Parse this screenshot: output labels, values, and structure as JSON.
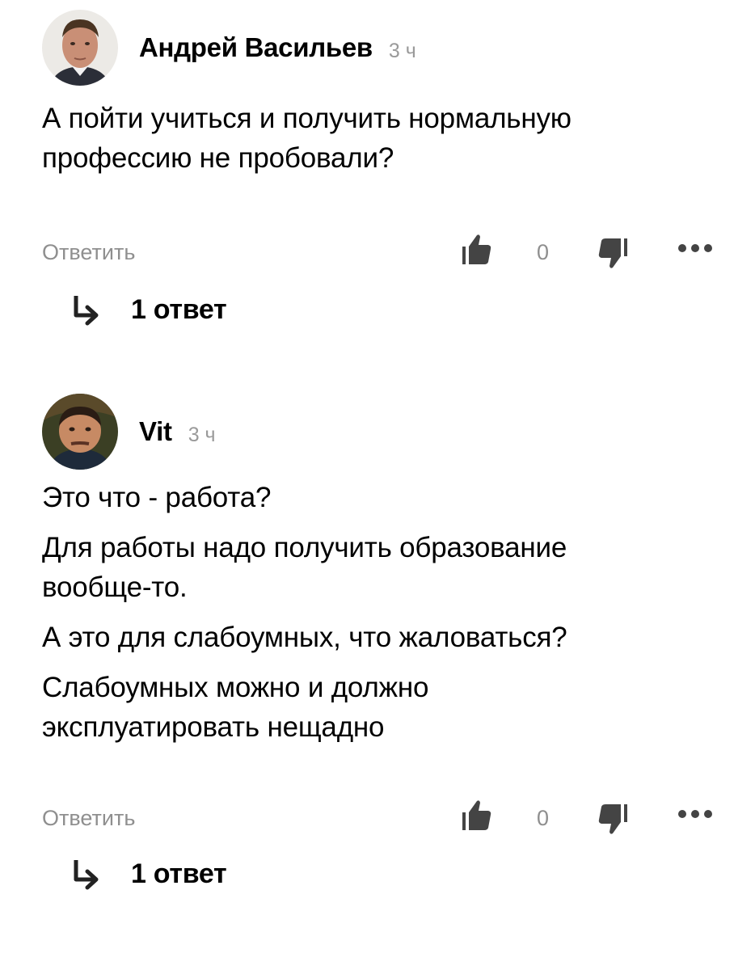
{
  "comments": [
    {
      "author": "Андрей Васильев",
      "time": "3 ч",
      "paragraphs": [
        [
          "А пойти учиться и получить нормальную",
          "профессию не пробовали?"
        ]
      ],
      "reply_label": "Ответить",
      "like_count": "0",
      "replies_label": "1 ответ"
    },
    {
      "author": "Vit",
      "time": "3 ч",
      "paragraphs": [
        [
          "Это что - работа?"
        ],
        [
          "Для работы надо получить образование",
          "вообще-то."
        ],
        [
          "А это для слабоумных, что жаловаться?"
        ],
        [
          "Слабоумных можно и должно",
          "эксплуатировать нещадно"
        ]
      ],
      "reply_label": "Ответить",
      "like_count": "0",
      "replies_label": "1 ответ"
    }
  ],
  "icons": {
    "like": "thumbs-up-icon",
    "dislike": "thumbs-down-icon",
    "more": "more-dots-icon",
    "replies": "reply-arrow-icon"
  },
  "colors": {
    "text": "#000000",
    "muted": "#8f8f8f",
    "icon": "#444444"
  }
}
